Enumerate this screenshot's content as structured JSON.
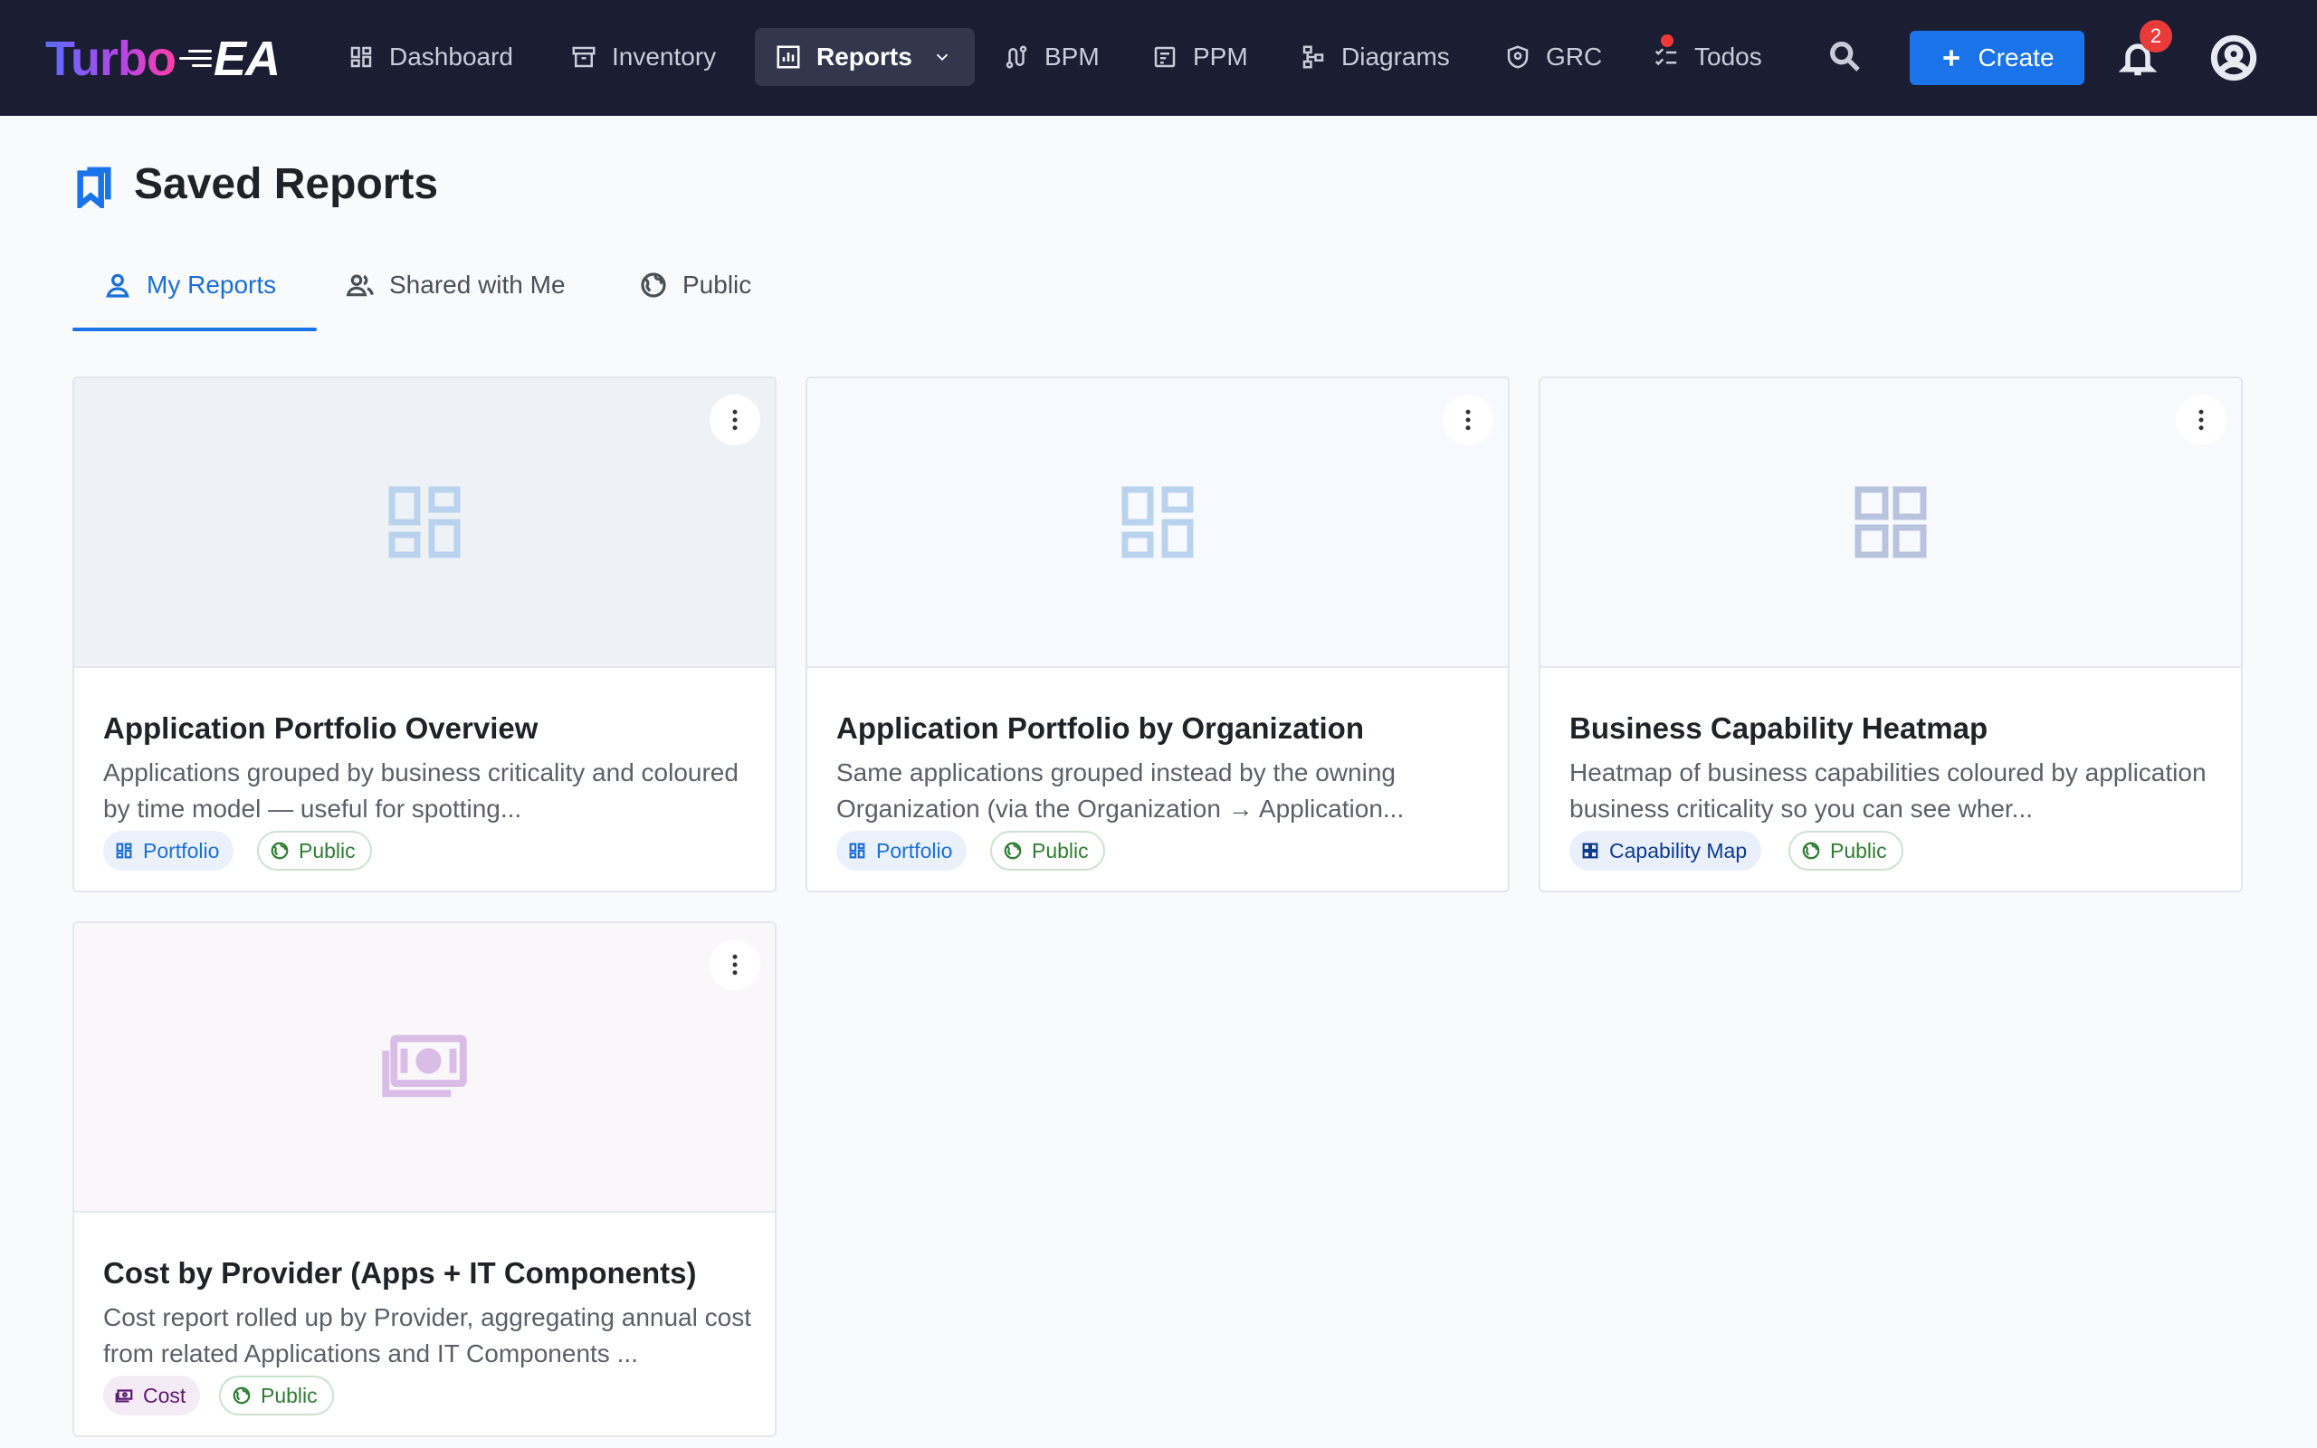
{
  "app": {
    "logo_turbo": "Turbo",
    "logo_ea": "EA"
  },
  "nav": {
    "items": [
      {
        "label": "Dashboard",
        "icon": "dashboard-icon"
      },
      {
        "label": "Inventory",
        "icon": "archive-icon"
      },
      {
        "label": "Reports",
        "icon": "bar-chart-icon",
        "active": true
      },
      {
        "label": "BPM",
        "icon": "route-icon"
      },
      {
        "label": "PPM",
        "icon": "project-icon"
      },
      {
        "label": "Diagrams",
        "icon": "hierarchy-icon"
      },
      {
        "label": "GRC",
        "icon": "shield-icon"
      },
      {
        "label": "Todos",
        "icon": "checklist-icon"
      }
    ],
    "create_label": "Create",
    "notification_count": "2"
  },
  "page": {
    "title": "Saved Reports"
  },
  "tabs": [
    {
      "label": "My Reports",
      "active": true
    },
    {
      "label": "Shared with Me"
    },
    {
      "label": "Public"
    }
  ],
  "reports": [
    {
      "title": "Application Portfolio Overview",
      "description": "Applications grouped by business criticality and coloured by time model — useful for spotting...",
      "type_label": "Portfolio",
      "visibility": "Public",
      "thumb_color": "#eef2f6",
      "icon_color": "#b9d3ee"
    },
    {
      "title": "Application Portfolio by Organization",
      "description": "Same applications grouped instead by the owning Organization (via the Organization → Application...",
      "type_label": "Portfolio",
      "visibility": "Public",
      "thumb_color": "#f6f9fd",
      "icon_color": "#b9d3ee"
    },
    {
      "title": "Business Capability Heatmap",
      "description": "Heatmap of business capabilities coloured by application business criticality so you can see wher...",
      "type_label": "Capability Map",
      "visibility": "Public",
      "thumb_color": "#f7f9fc",
      "icon_color": "#b8c4de"
    },
    {
      "title": "Cost by Provider (Apps + IT Components)",
      "description": "Cost report rolled up by Provider, aggregating annual cost from related Applications and IT Components ...",
      "type_label": "Cost",
      "visibility": "Public",
      "thumb_color": "#faf7fb",
      "icon_color": "#d9bde6"
    }
  ]
}
